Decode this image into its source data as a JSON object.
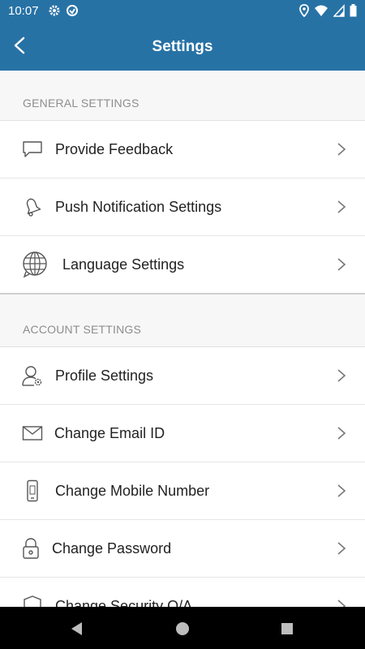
{
  "status_bar": {
    "time": "10:07"
  },
  "app_bar": {
    "title": "Settings"
  },
  "sections": {
    "general": {
      "title": "GENERAL SETTINGS",
      "items": [
        {
          "label": "Provide Feedback"
        },
        {
          "label": "Push Notification Settings"
        },
        {
          "label": "Language Settings"
        }
      ]
    },
    "account": {
      "title": "ACCOUNT SETTINGS",
      "items": [
        {
          "label": "Profile Settings"
        },
        {
          "label": "Change Email ID"
        },
        {
          "label": "Change Mobile Number"
        },
        {
          "label": "Change Password"
        },
        {
          "label": "Change Security Q/A"
        }
      ]
    }
  },
  "colors": {
    "primary": "#2772a5",
    "section_bg": "#f7f7f7",
    "text": "#222222",
    "muted": "#8d8d8d"
  },
  "icons": [
    "gear-icon",
    "sync-icon",
    "location-icon",
    "wifi-icon",
    "signal-icon",
    "battery-icon",
    "back-arrow-icon",
    "chat-bubble-icon",
    "bell-icon",
    "globe-icon",
    "profile-gear-icon",
    "envelope-icon",
    "mobile-phone-icon",
    "lock-icon",
    "shield-icon",
    "chevron-right-icon",
    "nav-back-icon",
    "nav-home-icon",
    "nav-recents-icon"
  ]
}
